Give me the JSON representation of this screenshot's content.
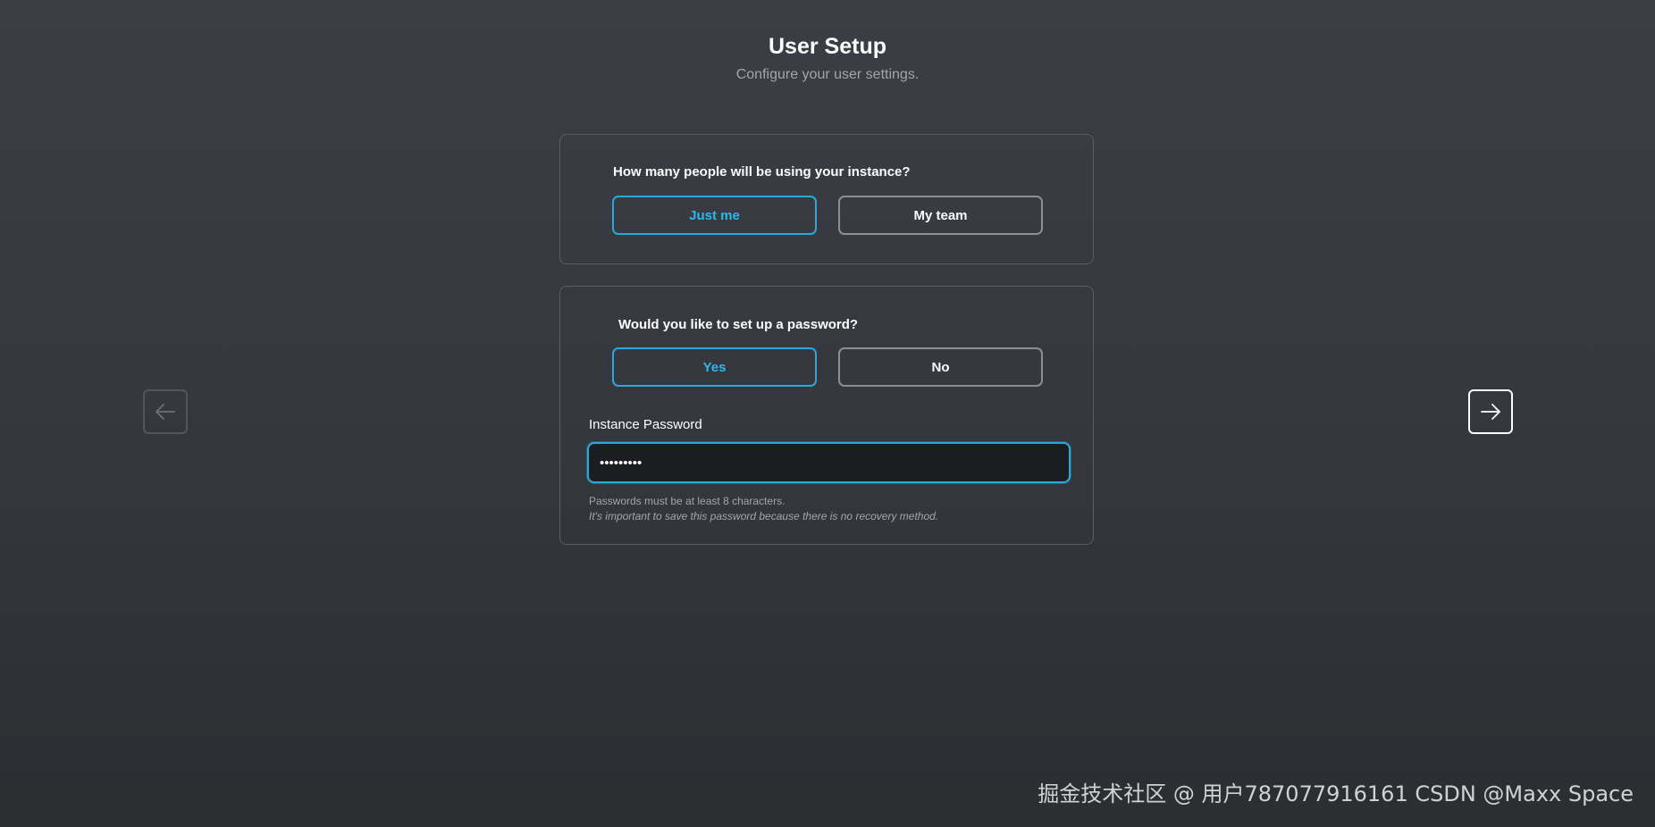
{
  "header": {
    "title": "User Setup",
    "subtitle": "Configure your user settings."
  },
  "users_question": {
    "label": "How many people will be using your instance?",
    "options": [
      {
        "label": "Just me",
        "selected": true
      },
      {
        "label": "My team",
        "selected": false
      }
    ]
  },
  "password_question": {
    "label": "Would you like to set up a password?",
    "options": [
      {
        "label": "Yes",
        "selected": true
      },
      {
        "label": "No",
        "selected": false
      }
    ],
    "field_label": "Instance Password",
    "field_value": "testtesta",
    "hint_1": "Passwords must be at least 8 characters.",
    "hint_2": "It's important to save this password because there is no recovery method."
  },
  "navigation": {
    "back_icon": "arrow-left-icon",
    "next_icon": "arrow-right-icon"
  },
  "colors": {
    "accent": "#2aa8d6",
    "muted_text": "#a3a6ad"
  },
  "watermark": "掘金技术社区 @ 用户787077916161 CSDN @Maxx Space"
}
